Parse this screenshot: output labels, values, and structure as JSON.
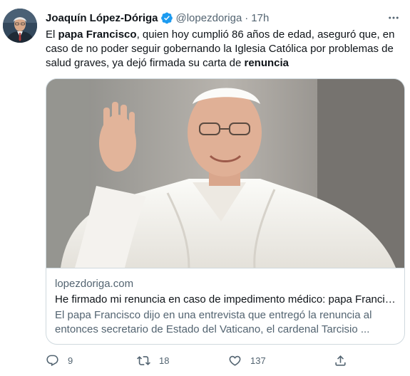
{
  "author": {
    "name": "Joaquín López-Dóriga",
    "handle": "@lopezdoriga",
    "time": "17h",
    "separator": "·",
    "verified": true,
    "avatar_icon": "avatar-portrait"
  },
  "tweet": {
    "segments": [
      {
        "text": "El ",
        "bold": false
      },
      {
        "text": "papa Francisco",
        "bold": true
      },
      {
        "text": ", quien hoy cumplió 86 años de edad, aseguró que, en caso de no poder seguir gobernando la Iglesia Católica por problemas de salud graves, ya dejó firmada su carta de ",
        "bold": false
      },
      {
        "text": "renuncia",
        "bold": true
      }
    ]
  },
  "card": {
    "image_icon": "photo-pope-waving",
    "domain": "lopezdoriga.com",
    "title": "He firmado mi renuncia en caso de impedimento médico: papa Francisco",
    "description": "El papa Francisco dijo en una entrevista que entregó la renuncia al entonces secretario de Estado del Vaticano, el cardenal Tarcisio ..."
  },
  "actions": {
    "reply": {
      "icon": "reply-icon",
      "count": "9"
    },
    "retweet": {
      "icon": "retweet-icon",
      "count": "18"
    },
    "like": {
      "icon": "heart-icon",
      "count": "137"
    },
    "share": {
      "icon": "share-icon",
      "count": ""
    }
  },
  "colors": {
    "text": "#0f1419",
    "secondary": "#536471",
    "verified": "#1d9bf0",
    "border": "#cfd9de"
  }
}
